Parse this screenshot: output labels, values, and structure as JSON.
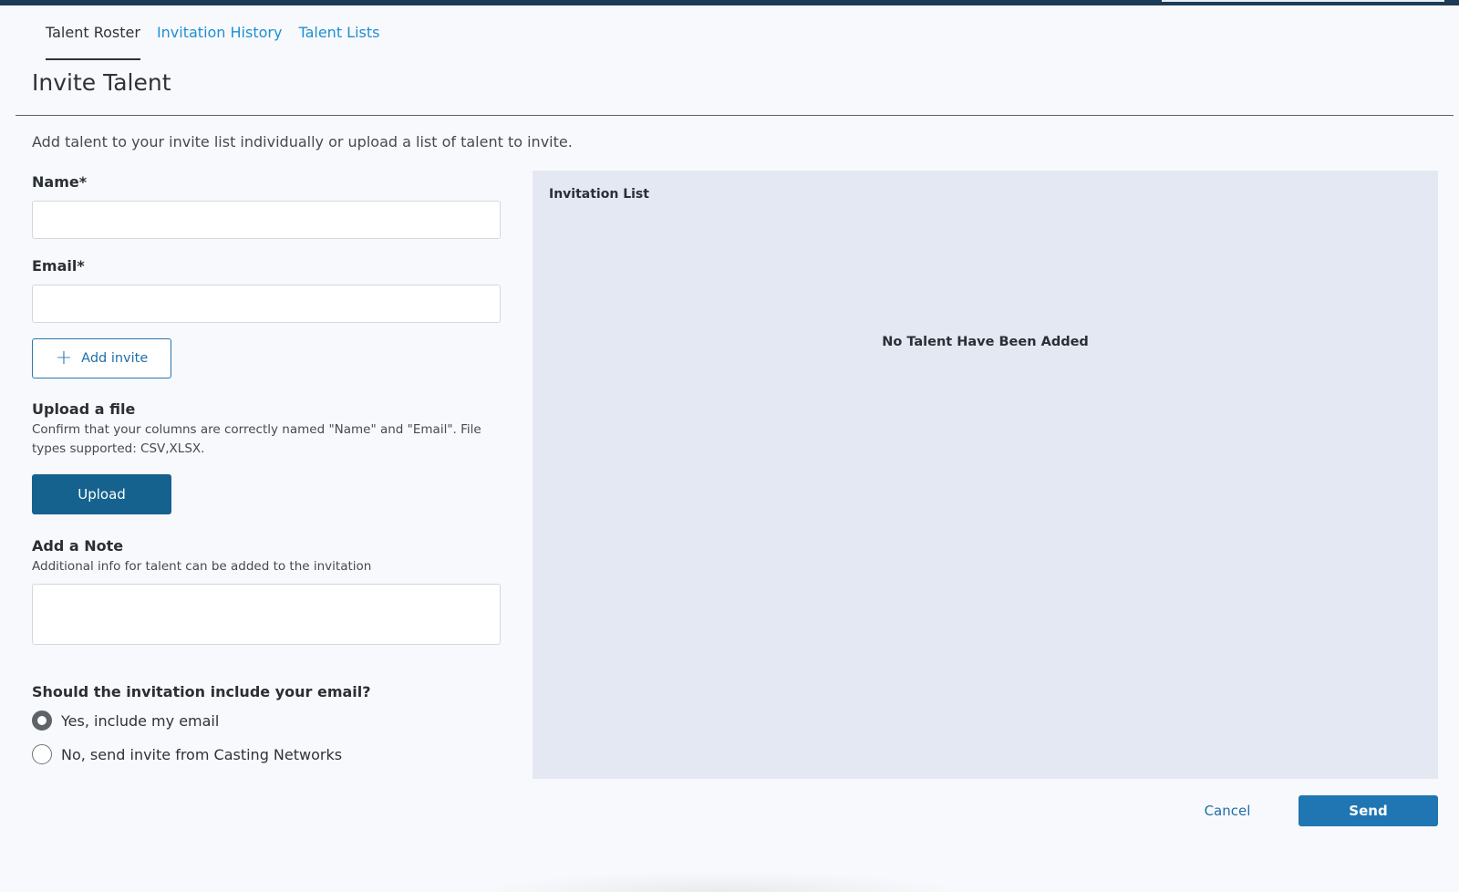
{
  "tabs": [
    {
      "label": "Talent Roster",
      "active": true
    },
    {
      "label": "Invitation History",
      "active": false
    },
    {
      "label": "Talent Lists",
      "active": false
    }
  ],
  "page": {
    "title": "Invite Talent",
    "intro": "Add talent to your invite list individually or upload a list of talent to invite."
  },
  "form": {
    "name_label": "Name*",
    "name_value": "",
    "email_label": "Email*",
    "email_value": "",
    "add_invite_label": "Add invite",
    "upload_title": "Upload a file",
    "upload_desc_line1": "Confirm that your columns are correctly named \"Name\" and \"Email\". File",
    "upload_desc_line2": "types supported: CSV,XLSX.",
    "upload_label": "Upload",
    "note_title": "Add a Note",
    "note_desc": "Additional info for talent can be added to the invitation",
    "note_value": "",
    "email_question": "Should the invitation include your email?",
    "radio_options": [
      {
        "label": "Yes, include my email",
        "checked": true
      },
      {
        "label": "No, send invite from Casting Networks",
        "checked": false
      }
    ]
  },
  "invitation_list": {
    "title": "Invitation List",
    "empty_message": "No Talent Have Been Added"
  },
  "actions": {
    "cancel_label": "Cancel",
    "send_label": "Send"
  },
  "colors": {
    "accent": "#1f76b3",
    "upload_button": "#15628f",
    "panel_bg": "#e3e8f2",
    "topbar": "#1c3b57"
  }
}
